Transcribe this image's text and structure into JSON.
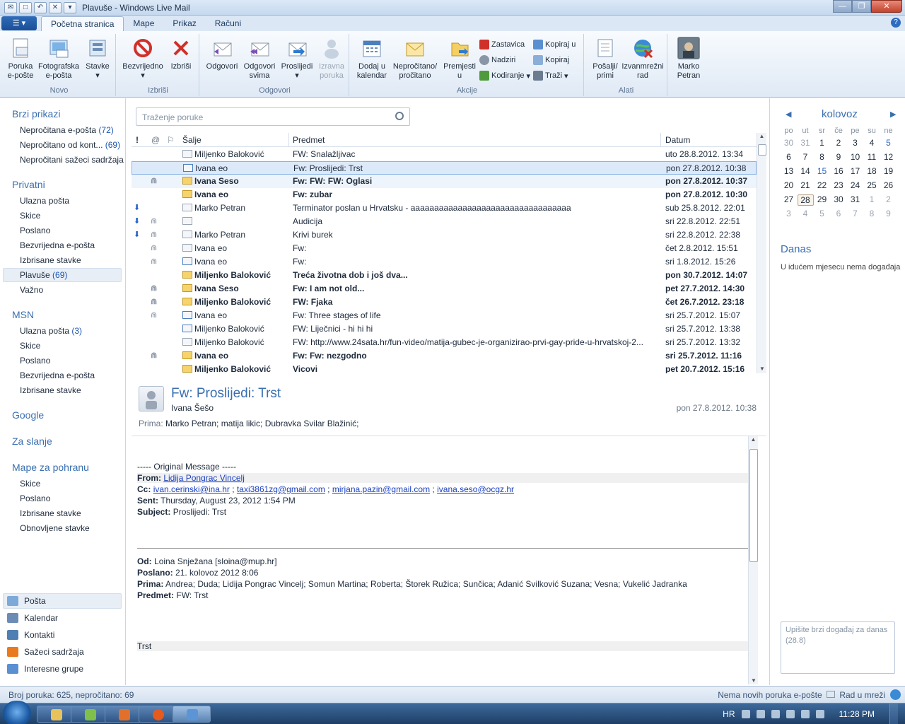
{
  "window": {
    "title": "Plavuše - Windows Live Mail"
  },
  "tabs": [
    "Početna stranica",
    "Mape",
    "Prikaz",
    "Računi"
  ],
  "ribbon": {
    "novo": {
      "label": "Novo",
      "poruka": "Poruka\ne-pošte",
      "foto": "Fotografska\ne-pošta",
      "stavke": "Stavke"
    },
    "izbrisi": {
      "label": "Izbriši",
      "bezvrijedno": "Bezvrijedno",
      "izbrisi": "Izbriši"
    },
    "odgovori": {
      "label": "Odgovori",
      "odgovori": "Odgovori",
      "odgovori_svima": "Odgovori\nsvima",
      "proslijedi": "Proslijedi",
      "izravna": "Izravna\nporuka"
    },
    "akcije": {
      "label": "Akcije",
      "dodaj": "Dodaj u\nkalendar",
      "neprocitano": "Nepročitano/\npročitano",
      "premjesti": "Premjesti\nu",
      "zastavica": "Zastavica",
      "nadziri": "Nadziri",
      "kodiranje": "Kodiranje",
      "kopiraj_u": "Kopiraj u",
      "kopiraj": "Kopiraj",
      "trazi": "Traži"
    },
    "alati": {
      "label": "Alati",
      "posalji": "Pošalji/\nprimi",
      "izvanmrezni": "Izvanmrežni\nrad"
    },
    "user": {
      "name": "Marko\nPetran"
    }
  },
  "nav": {
    "brzi": {
      "title": "Brzi prikazi",
      "items": [
        {
          "label": "Nepročitana e-pošta",
          "count": "(72)"
        },
        {
          "label": "Nepročitano od kont...",
          "count": "(69)"
        },
        {
          "label": "Nepročitani sažeci sadržaja",
          "count": ""
        }
      ]
    },
    "privatni": {
      "title": "Privatni",
      "items": [
        {
          "label": "Ulazna pošta",
          "count": ""
        },
        {
          "label": "Skice",
          "count": ""
        },
        {
          "label": "Poslano",
          "count": ""
        },
        {
          "label": "Bezvrijedna e-pošta",
          "count": ""
        },
        {
          "label": "Izbrisane stavke",
          "count": ""
        },
        {
          "label": "Plavuše",
          "count": "(69)"
        },
        {
          "label": "Važno",
          "count": ""
        }
      ]
    },
    "msn": {
      "title": "MSN",
      "items": [
        {
          "label": "Ulazna pošta",
          "count": "(3)"
        },
        {
          "label": "Skice",
          "count": ""
        },
        {
          "label": "Poslano",
          "count": ""
        },
        {
          "label": "Bezvrijedna e-pošta",
          "count": ""
        },
        {
          "label": "Izbrisane stavke",
          "count": ""
        }
      ]
    },
    "google": "Google",
    "zaslanje": "Za slanje",
    "mape": {
      "title": "Mape za pohranu",
      "items": [
        {
          "label": "Skice"
        },
        {
          "label": "Poslano"
        },
        {
          "label": "Izbrisane stavke"
        },
        {
          "label": "Obnovljene stavke"
        }
      ]
    },
    "bottom": [
      "Pošta",
      "Kalendar",
      "Kontakti",
      "Sažeci sadržaja",
      "Interesne grupe"
    ]
  },
  "search": {
    "placeholder": "Traženje poruke"
  },
  "list": {
    "headers": {
      "flag": "!",
      "clip": "@",
      "flag2": "⚐",
      "from": "Šalje",
      "subject": "Predmet",
      "date": "Datum"
    },
    "rows": [
      {
        "from": "Miljenko Baloković",
        "subject": "FW: Snalažljivac",
        "date": "uto 28.8.2012. 13:34",
        "bold": false,
        "clip": false,
        "arrow": false,
        "env": "read"
      },
      {
        "from": "Ivana eo",
        "subject": "Fw: Proslijedi: Trst",
        "date": "pon 27.8.2012. 10:38",
        "bold": false,
        "clip": false,
        "arrow": false,
        "env": "fwd",
        "sel": true
      },
      {
        "from": "Ivana Seso",
        "subject": "Fw: FW: FW: Oglasi",
        "date": "pon 27.8.2012. 10:37",
        "bold": true,
        "clip": true,
        "arrow": false,
        "env": "unread"
      },
      {
        "from": "Ivana eo",
        "subject": "Fw: zubar",
        "date": "pon 27.8.2012. 10:30",
        "bold": true,
        "clip": false,
        "arrow": false,
        "env": "unread"
      },
      {
        "from": "Marko Petran",
        "subject": "Terminator poslan u Hrvatsku - aaaaaaaaaaaaaaaaaaaaaaaaaaaaaaaaaa",
        "date": "sub 25.8.2012. 22:01",
        "bold": false,
        "clip": false,
        "arrow": true,
        "env": "read"
      },
      {
        "from": "",
        "subject": "Audicija",
        "date": "sri 22.8.2012. 22:51",
        "bold": false,
        "clip": true,
        "arrow": true,
        "env": "read"
      },
      {
        "from": "Marko Petran",
        "subject": "Krivi burek",
        "date": "sri 22.8.2012. 22:38",
        "bold": false,
        "clip": true,
        "arrow": true,
        "env": "read"
      },
      {
        "from": "Ivana eo",
        "subject": "Fw:",
        "date": "čet 2.8.2012. 15:51",
        "bold": false,
        "clip": true,
        "arrow": false,
        "env": "read"
      },
      {
        "from": "Ivana eo",
        "subject": "Fw:",
        "date": "sri 1.8.2012. 15:26",
        "bold": false,
        "clip": true,
        "arrow": false,
        "env": "fwd"
      },
      {
        "from": "Miljenko Baloković",
        "subject": "Treća životna dob i još dva...",
        "date": "pon 30.7.2012. 14:07",
        "bold": true,
        "clip": false,
        "arrow": false,
        "env": "unread"
      },
      {
        "from": "Ivana Seso",
        "subject": "Fw: I am not old...",
        "date": "pet 27.7.2012. 14:30",
        "bold": true,
        "clip": true,
        "arrow": false,
        "env": "unread"
      },
      {
        "from": "Miljenko Baloković",
        "subject": "FW: Fjaka",
        "date": "čet 26.7.2012. 23:18",
        "bold": true,
        "clip": true,
        "arrow": false,
        "env": "unread"
      },
      {
        "from": "Ivana eo",
        "subject": "Fw: Three stages of life",
        "date": "sri 25.7.2012. 15:07",
        "bold": false,
        "clip": true,
        "arrow": false,
        "env": "fwd"
      },
      {
        "from": "Miljenko Baloković",
        "subject": "FW: Liječnici - hi hi hi",
        "date": "sri 25.7.2012. 13:38",
        "bold": false,
        "clip": false,
        "arrow": false,
        "env": "fwd"
      },
      {
        "from": "Miljenko Baloković",
        "subject": "FW: http://www.24sata.hr/fun-video/matija-gubec-je-organizirao-prvi-gay-pride-u-hrvatskoj-2...",
        "date": "sri 25.7.2012. 13:32",
        "bold": false,
        "clip": false,
        "arrow": false,
        "env": "read"
      },
      {
        "from": "Ivana eo",
        "subject": "Fw: Fw: nezgodno",
        "date": "sri 25.7.2012. 11:16",
        "bold": true,
        "clip": true,
        "arrow": false,
        "env": "unread"
      },
      {
        "from": "Miljenko Baloković",
        "subject": "Vicovi",
        "date": "pet 20.7.2012. 15:16",
        "bold": true,
        "clip": false,
        "arrow": false,
        "env": "unread"
      }
    ]
  },
  "preview": {
    "title": "Fw: Proslijedi: Trst",
    "from": "Ivana Šešo",
    "date": "pon 27.8.2012. 10:38",
    "to_label": "Prima:",
    "to": "Marko Petran; matija likic; Dubravka Svilar Blažinić;",
    "orig": "----- Original Message -----",
    "from_label": "From:",
    "from_val": "Lidija Pongrac Vincelj",
    "cc_label": "Cc:",
    "cc1": "ivan.cerinski@ina.hr",
    "cc2": "taxi3861zg@gmail.com",
    "cc3": "mirjana.pazin@gmail.com",
    "cc4": "ivana.seso@ocgz.hr",
    "sent_label": "Sent:",
    "sent_val": "Thursday, August 23, 2012 1:54 PM",
    "subject_label": "Subject:",
    "subject_val": "Proslijedi: Trst",
    "od_label": "Od:",
    "od_val": "Loina Snježana [sloina@mup.hr]",
    "poslano_label": "Poslano:",
    "poslano_val": "21. kolovoz 2012 8:06",
    "prima_label": "Prima:",
    "prima_val": "Andrea; Duda; Lidija Pongrac Vincelj; Somun Martina; Roberta; Štorek Ružica; Sunčica; Adanić Svilković Suzana; Vesna; Vukelić Jadranka",
    "predmet_label": "Predmet:",
    "predmet_val": "FW: Trst",
    "body_word": "Trst"
  },
  "calendar": {
    "month": "kolovoz",
    "days": [
      "po",
      "ut",
      "sr",
      "če",
      "pe",
      "su",
      "ne"
    ],
    "weeks": [
      [
        "30",
        "31",
        "1",
        "2",
        "3",
        "4",
        "5"
      ],
      [
        "6",
        "7",
        "8",
        "9",
        "10",
        "11",
        "12"
      ],
      [
        "13",
        "14",
        "15",
        "16",
        "17",
        "18",
        "19"
      ],
      [
        "20",
        "21",
        "22",
        "23",
        "24",
        "25",
        "26"
      ],
      [
        "27",
        "28",
        "29",
        "30",
        "31",
        "1",
        "2"
      ],
      [
        "3",
        "4",
        "5",
        "6",
        "7",
        "8",
        "9"
      ]
    ],
    "today": "Danas",
    "no_events": "U idućem mjesecu nema događaja",
    "quick_placeholder": "Upišite brzi događaj za danas (28.8)"
  },
  "status": {
    "left": "Broj poruka: 625, nepročitano: 69",
    "right": "Nema novih poruka e-pošte",
    "online": "Rad u mreži"
  },
  "taskbar": {
    "lang": "HR",
    "time": "11:28 PM"
  }
}
